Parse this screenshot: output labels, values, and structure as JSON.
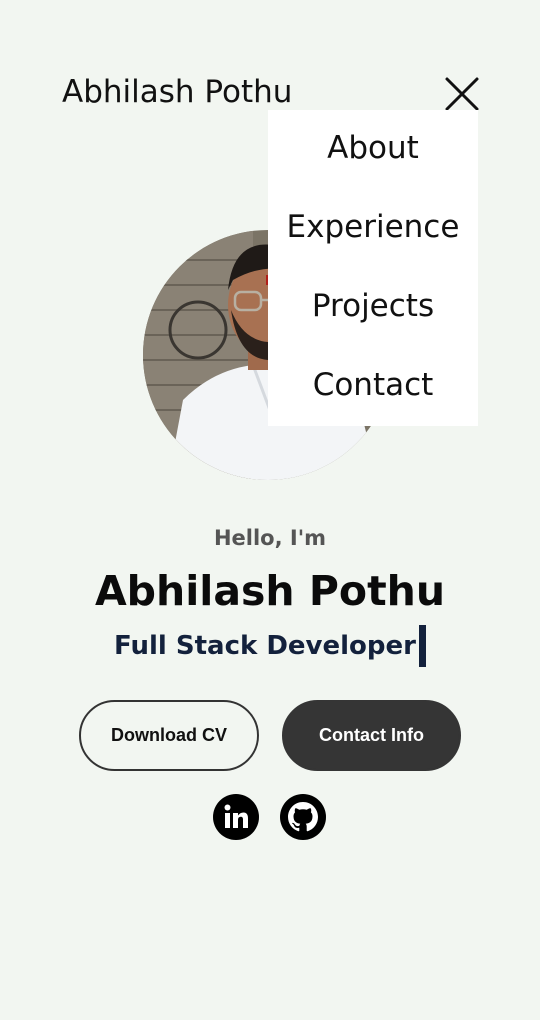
{
  "header": {
    "brand": "Abhilash Pothu",
    "close_icon": "close-icon"
  },
  "menu": {
    "items": [
      {
        "label": "About"
      },
      {
        "label": "Experience"
      },
      {
        "label": "Projects"
      },
      {
        "label": "Contact"
      }
    ]
  },
  "profile": {
    "photo_icon": "profile-photo",
    "greeting": "Hello, I'm",
    "name": "Abhilash Pothu",
    "role": "Full Stack Developer"
  },
  "buttons": {
    "download_cv": "Download CV",
    "contact_info": "Contact Info"
  },
  "social": {
    "linkedin_icon": "linkedin-icon",
    "github_icon": "github-icon"
  },
  "colors": {
    "background": "#f2f6f1",
    "menu_background": "#ffffff",
    "role_text": "#13213c",
    "solid_button": "#353535",
    "social_icon": "#000000"
  }
}
